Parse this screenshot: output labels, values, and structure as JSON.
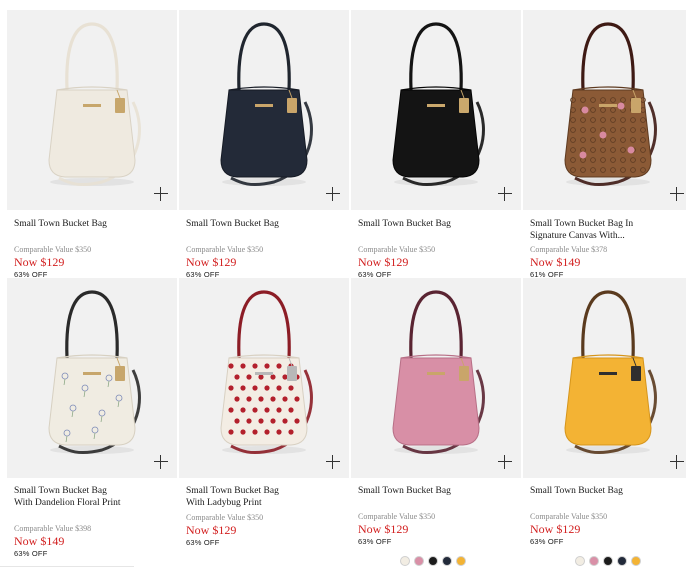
{
  "products": [
    {
      "name": "Small Town Bucket Bag",
      "comparable": "Comparable Value $350",
      "price": "Now $129",
      "discount": "63% OFF",
      "bag_color": "#efeae0",
      "bag_edge": "#d9d2c4",
      "handle_color": "#e8e1d4",
      "tag_color": "#c7a66b",
      "pattern": "plain"
    },
    {
      "name": "Small Town Bucket Bag",
      "comparable": "Comparable Value $350",
      "price": "Now $129",
      "discount": "63% OFF",
      "bag_color": "#232a38",
      "bag_edge": "#161b25",
      "handle_color": "#20262f",
      "tag_color": "#c9a56a",
      "pattern": "plain"
    },
    {
      "name": "Small Town Bucket Bag",
      "comparable": "Comparable Value $350",
      "price": "Now $129",
      "discount": "63% OFF",
      "bag_color": "#141414",
      "bag_edge": "#050505",
      "handle_color": "#141414",
      "tag_color": "#caa86c",
      "pattern": "plain"
    },
    {
      "name": "Small Town Bucket Bag In Signature Canvas With...",
      "comparable": "Comparable Value $378",
      "price": "Now $149",
      "discount": "61% OFF",
      "bag_color": "#8b5a36",
      "bag_edge": "#5e3a20",
      "handle_color": "#3e1a14",
      "tag_color": "#c9a56a",
      "pattern": "signature"
    },
    {
      "name": "Small Town Bucket Bag With Dandelion Floral Print",
      "comparable": "Comparable Value $398",
      "price": "Now $149",
      "discount": "63% OFF",
      "bag_color": "#f0ece2",
      "bag_edge": "#d7d0c1",
      "handle_color": "#2a2a2a",
      "tag_color": "#c7a66b",
      "pattern": "floral"
    },
    {
      "name": "Small Town Bucket Bag With Ladybug Print",
      "comparable": "Comparable Value $350",
      "price": "Now $129",
      "discount": "63% OFF",
      "bag_color": "#f3ede4",
      "bag_edge": "#d8d0c2",
      "handle_color": "#8c1d26",
      "tag_color": "#b8b8b8",
      "pattern": "ladybug"
    },
    {
      "name": "Small Town Bucket Bag",
      "comparable": "Comparable Value $350",
      "price": "Now $129",
      "discount": "63% OFF",
      "bag_color": "#d88fa6",
      "bag_edge": "#b76f86",
      "handle_color": "#5a2432",
      "tag_color": "#c9a56a",
      "pattern": "plain"
    },
    {
      "name": "Small Town Bucket Bag",
      "comparable": "Comparable Value $350",
      "price": "Now $129",
      "discount": "63% OFF",
      "bag_color": "#f3b334",
      "bag_edge": "#d6951b",
      "handle_color": "#5a3a1e",
      "tag_color": "#2f2f2f",
      "pattern": "plain"
    }
  ],
  "swatch_colors": [
    "#f2ede3",
    "#d990a7",
    "#1b1b1b",
    "#222a3a",
    "#f3b334"
  ],
  "colors": {
    "price_red": "#d21f1f",
    "tile_bg": "#f1f1f1"
  },
  "icons": {
    "add": "plus-icon",
    "expand": "chevron-down-icon"
  }
}
